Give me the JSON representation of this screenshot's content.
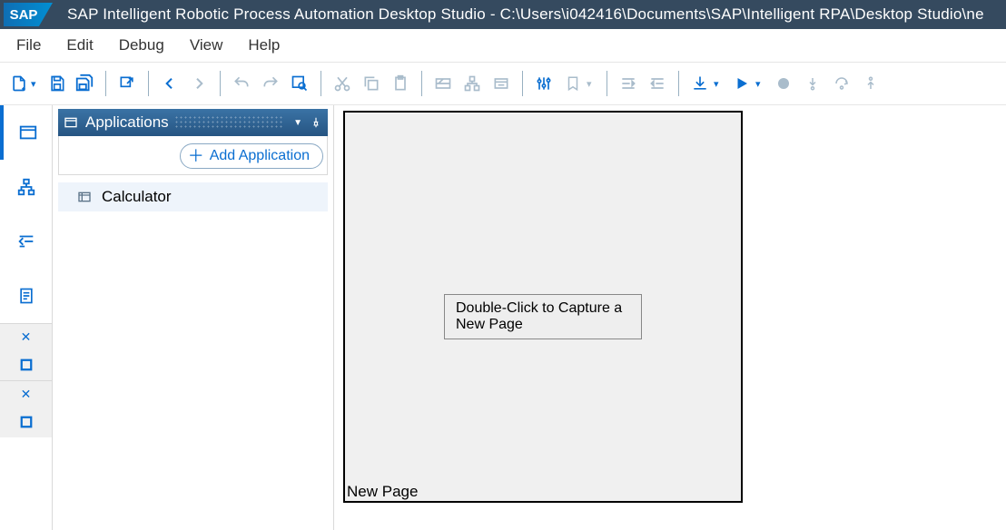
{
  "title": "SAP Intelligent Robotic Process Automation Desktop Studio - C:\\Users\\i042416\\Documents\\SAP\\Intelligent RPA\\Desktop Studio\\ne",
  "logo_text": "SAP",
  "menu": [
    "File",
    "Edit",
    "Debug",
    "View",
    "Help"
  ],
  "sidepanel": {
    "title": "Applications",
    "add_button": "Add Application",
    "items": [
      "Calculator"
    ]
  },
  "canvas": {
    "hint": "Double-Click to Capture a New Page",
    "page_label": "New Page"
  }
}
